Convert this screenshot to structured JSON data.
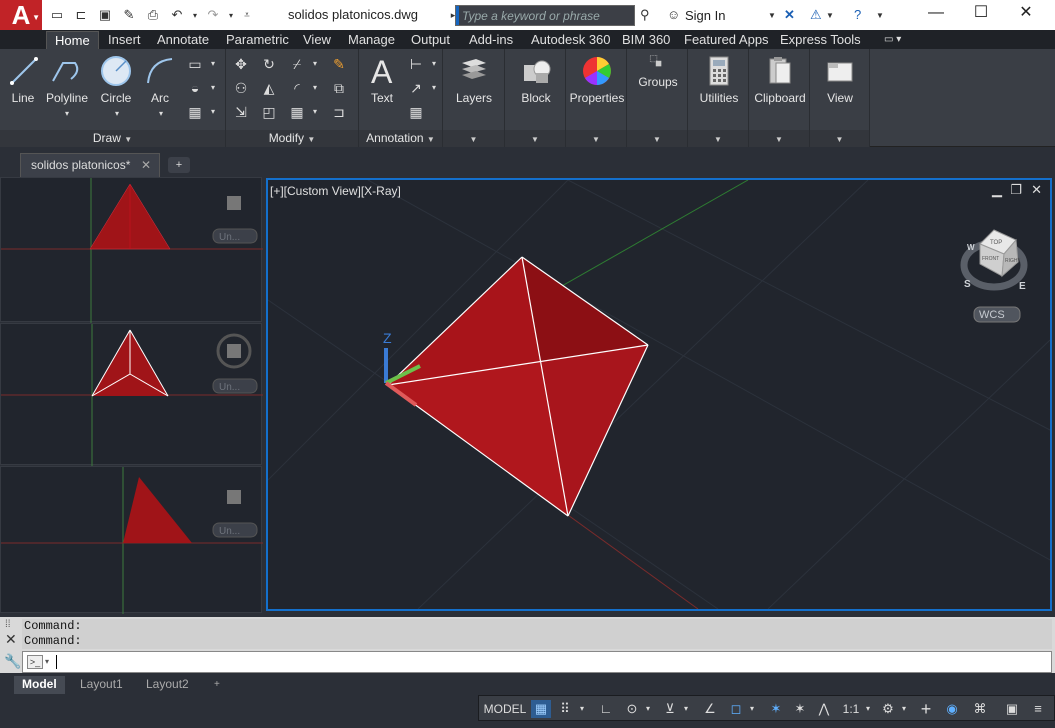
{
  "titlebar": {
    "document_title": "solidos platonicos.dwg",
    "search_placeholder": "Type a keyword or phrase",
    "sign_in_label": "Sign In",
    "app_letter": "A"
  },
  "ribbon_tabs": [
    "Home",
    "Insert",
    "Annotate",
    "Parametric",
    "View",
    "Manage",
    "Output",
    "Add-ins",
    "Autodesk 360",
    "BIM 360",
    "Featured Apps",
    "Express Tools"
  ],
  "ribbon": {
    "draw": {
      "title": "Draw",
      "line": "Line",
      "polyline": "Polyline",
      "circle": "Circle",
      "arc": "Arc"
    },
    "modify": {
      "title": "Modify"
    },
    "annotation": {
      "title": "Annotation",
      "text": "Text"
    },
    "layers": "Layers",
    "block": "Block",
    "properties": "Properties",
    "groups": "Groups",
    "utilities": "Utilities",
    "clipboard": "Clipboard",
    "view": "View"
  },
  "file_tab": {
    "name": "solidos platonicos*"
  },
  "viewport": {
    "label": "[+][Custom View][X-Ray]",
    "viewcube": {
      "top_face": "TOP",
      "left_face": "FRONT",
      "right_face": "RIGHT",
      "compass_s": "S",
      "compass_e": "E",
      "compass_w": "W",
      "wcs": "WCS"
    },
    "small_vp_label": "Un..."
  },
  "command": {
    "history": [
      "Command:",
      "Command:"
    ]
  },
  "layout_tabs": [
    "Model",
    "Layout1",
    "Layout2"
  ],
  "status": {
    "model": "MODEL",
    "scale": "1:1"
  }
}
